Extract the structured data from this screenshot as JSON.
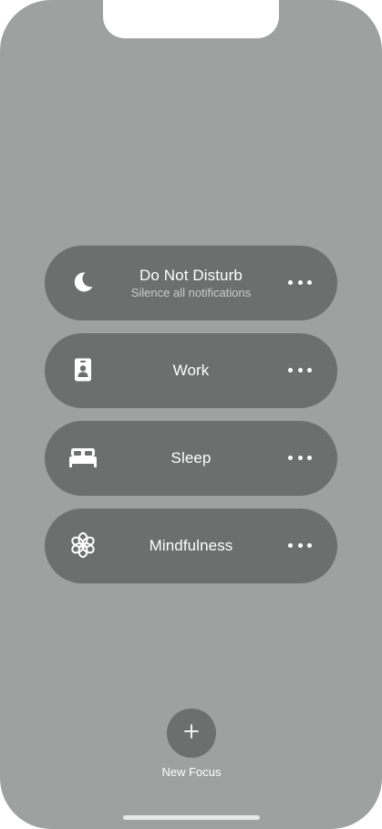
{
  "focus_modes": [
    {
      "title": "Do Not Disturb",
      "subtitle": "Silence all notifications",
      "icon": "moon-icon"
    },
    {
      "title": "Work",
      "subtitle": "",
      "icon": "id-badge-icon"
    },
    {
      "title": "Sleep",
      "subtitle": "",
      "icon": "bed-icon"
    },
    {
      "title": "Mindfulness",
      "subtitle": "",
      "icon": "mindfulness-flower-icon"
    }
  ],
  "new_focus": {
    "label": "New Focus",
    "icon": "plus-icon"
  },
  "colors": {
    "background": "#9ea1a0",
    "pill": "#6d6f6e",
    "text": "#ffffff",
    "subtext": "#c9cbca"
  }
}
